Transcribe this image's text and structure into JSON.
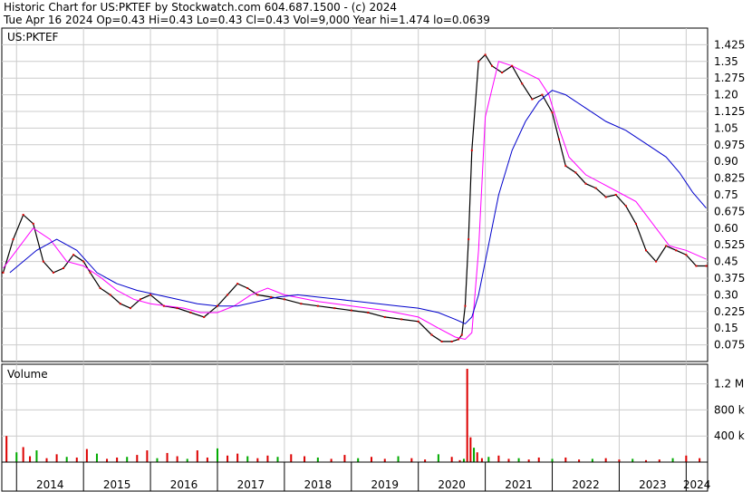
{
  "header": {
    "title": "Historic Chart for US:PKTEF by Stockwatch.com 604.687.1500 - (c) 2024",
    "quote": "Tue Apr 16 2024  Op=0.43  Hi=0.43  Lo=0.43  Cl=0.43  Vol=9,000  Year hi=1.474  lo=0.0639"
  },
  "chart_data": [
    {
      "type": "line",
      "title": "US:PKTEF",
      "ylim": [
        0,
        1.5
      ],
      "y_ticks": [
        "1.425",
        "1.35",
        "1.275",
        "1.20",
        "1.125",
        "1.05",
        "0.975",
        "0.90",
        "0.825",
        "0.75",
        "0.675",
        "0.60",
        "0.525",
        "0.45",
        "0.375",
        "0.30",
        "0.225",
        "0.15",
        "0.075"
      ],
      "grid": true,
      "series": [
        {
          "color": "#000000",
          "x": [
            2013.8,
            2013.95,
            2014.1,
            2014.25,
            2014.4,
            2014.55,
            2014.7,
            2014.85,
            2015.0,
            2015.1,
            2015.25,
            2015.4,
            2015.55,
            2015.7,
            2015.85,
            2016.0,
            2016.2,
            2016.4,
            2016.6,
            2016.8,
            2017.0,
            2017.15,
            2017.3,
            2017.45,
            2017.6,
            2017.8,
            2018.0,
            2018.25,
            2018.5,
            2018.75,
            2019.0,
            2019.25,
            2019.5,
            2019.75,
            2020.0,
            2020.2,
            2020.35,
            2020.5,
            2020.6,
            2020.65,
            2020.7,
            2020.75,
            2020.8,
            2020.9,
            2021.0,
            2021.1,
            2021.25,
            2021.4,
            2021.55,
            2021.7,
            2021.85,
            2022.0,
            2022.1,
            2022.2,
            2022.35,
            2022.5,
            2022.65,
            2022.8,
            2022.95,
            2023.1,
            2023.25,
            2023.4,
            2023.55,
            2023.7,
            2023.85,
            2024.0,
            2024.15,
            2024.3
          ],
          "y": [
            0.4,
            0.55,
            0.66,
            0.62,
            0.45,
            0.4,
            0.42,
            0.48,
            0.45,
            0.4,
            0.33,
            0.3,
            0.26,
            0.24,
            0.28,
            0.3,
            0.25,
            0.24,
            0.22,
            0.2,
            0.25,
            0.3,
            0.35,
            0.33,
            0.3,
            0.29,
            0.28,
            0.26,
            0.25,
            0.24,
            0.23,
            0.22,
            0.2,
            0.19,
            0.18,
            0.12,
            0.09,
            0.09,
            0.1,
            0.12,
            0.25,
            0.55,
            0.95,
            1.35,
            1.38,
            1.33,
            1.3,
            1.33,
            1.25,
            1.18,
            1.2,
            1.12,
            1.0,
            0.88,
            0.85,
            0.8,
            0.78,
            0.74,
            0.75,
            0.7,
            0.62,
            0.5,
            0.45,
            0.52,
            0.5,
            0.48,
            0.43,
            0.43
          ]
        },
        {
          "color": "#ff00ff",
          "x": [
            2013.8,
            2014.0,
            2014.25,
            2014.5,
            2014.75,
            2015.0,
            2015.25,
            2015.5,
            2015.75,
            2016.0,
            2016.25,
            2016.5,
            2016.75,
            2017.0,
            2017.25,
            2017.5,
            2017.75,
            2018.0,
            2018.5,
            2019.0,
            2019.5,
            2020.0,
            2020.3,
            2020.55,
            2020.7,
            2020.8,
            2020.9,
            2021.0,
            2021.2,
            2021.4,
            2021.6,
            2021.8,
            2021.95,
            2022.1,
            2022.25,
            2022.5,
            2022.75,
            2023.0,
            2023.25,
            2023.5,
            2023.75,
            2024.0,
            2024.3
          ],
          "y": [
            0.42,
            0.5,
            0.6,
            0.55,
            0.45,
            0.43,
            0.38,
            0.32,
            0.28,
            0.26,
            0.25,
            0.24,
            0.22,
            0.22,
            0.25,
            0.3,
            0.33,
            0.3,
            0.27,
            0.25,
            0.23,
            0.2,
            0.15,
            0.11,
            0.1,
            0.13,
            0.5,
            1.1,
            1.35,
            1.33,
            1.3,
            1.27,
            1.2,
            1.05,
            0.92,
            0.84,
            0.8,
            0.76,
            0.72,
            0.62,
            0.52,
            0.5,
            0.46
          ]
        },
        {
          "color": "#0000cc",
          "x": [
            2013.9,
            2014.3,
            2014.6,
            2014.9,
            2015.2,
            2015.5,
            2015.8,
            2016.1,
            2016.4,
            2016.7,
            2017.0,
            2017.3,
            2017.6,
            2017.9,
            2018.2,
            2018.5,
            2018.8,
            2019.1,
            2019.4,
            2019.7,
            2020.0,
            2020.3,
            2020.55,
            2020.7,
            2020.8,
            2020.9,
            2021.0,
            2021.2,
            2021.4,
            2021.6,
            2021.8,
            2022.0,
            2022.2,
            2022.5,
            2022.8,
            2023.1,
            2023.4,
            2023.7,
            2023.9,
            2024.1,
            2024.3
          ],
          "y": [
            0.4,
            0.5,
            0.55,
            0.5,
            0.4,
            0.35,
            0.32,
            0.3,
            0.28,
            0.26,
            0.25,
            0.25,
            0.27,
            0.29,
            0.3,
            0.29,
            0.28,
            0.27,
            0.26,
            0.25,
            0.24,
            0.22,
            0.19,
            0.17,
            0.2,
            0.3,
            0.45,
            0.75,
            0.95,
            1.08,
            1.17,
            1.22,
            1.2,
            1.14,
            1.08,
            1.04,
            0.98,
            0.92,
            0.85,
            0.76,
            0.69
          ]
        }
      ]
    },
    {
      "type": "bar",
      "title": "Volume",
      "ylim": [
        0,
        1500000
      ],
      "y_ticks": [
        "1.2 M",
        "800 k",
        "400 k"
      ],
      "x_ticks": [
        "2014",
        "2015",
        "2016",
        "2017",
        "2018",
        "2019",
        "2020",
        "2021",
        "2022",
        "2023",
        "2024"
      ],
      "x": [
        2013.85,
        2014.0,
        2014.1,
        2014.2,
        2014.3,
        2014.45,
        2014.6,
        2014.75,
        2014.9,
        2015.05,
        2015.2,
        2015.35,
        2015.5,
        2015.65,
        2015.8,
        2015.95,
        2016.1,
        2016.25,
        2016.4,
        2016.55,
        2016.7,
        2016.85,
        2017.0,
        2017.15,
        2017.3,
        2017.45,
        2017.6,
        2017.75,
        2017.9,
        2018.1,
        2018.3,
        2018.5,
        2018.7,
        2018.9,
        2019.1,
        2019.3,
        2019.5,
        2019.7,
        2019.9,
        2020.1,
        2020.3,
        2020.5,
        2020.62,
        2020.68,
        2020.73,
        2020.78,
        2020.83,
        2020.88,
        2020.95,
        2021.05,
        2021.2,
        2021.35,
        2021.5,
        2021.65,
        2021.8,
        2022.0,
        2022.2,
        2022.4,
        2022.6,
        2022.8,
        2023.0,
        2023.2,
        2023.4,
        2023.6,
        2023.8,
        2024.0,
        2024.2
      ],
      "values": [
        400000,
        150000,
        230000,
        90000,
        180000,
        60000,
        120000,
        80000,
        70000,
        200000,
        130000,
        50000,
        70000,
        80000,
        110000,
        180000,
        60000,
        140000,
        90000,
        50000,
        180000,
        70000,
        210000,
        100000,
        130000,
        90000,
        60000,
        100000,
        80000,
        120000,
        90000,
        70000,
        50000,
        110000,
        60000,
        80000,
        50000,
        90000,
        60000,
        40000,
        120000,
        80000,
        30000,
        50000,
        1430000,
        380000,
        220000,
        150000,
        60000,
        80000,
        100000,
        50000,
        60000,
        40000,
        70000,
        50000,
        70000,
        40000,
        50000,
        60000,
        40000,
        50000,
        30000,
        40000,
        60000,
        100000,
        60000
      ]
    }
  ]
}
